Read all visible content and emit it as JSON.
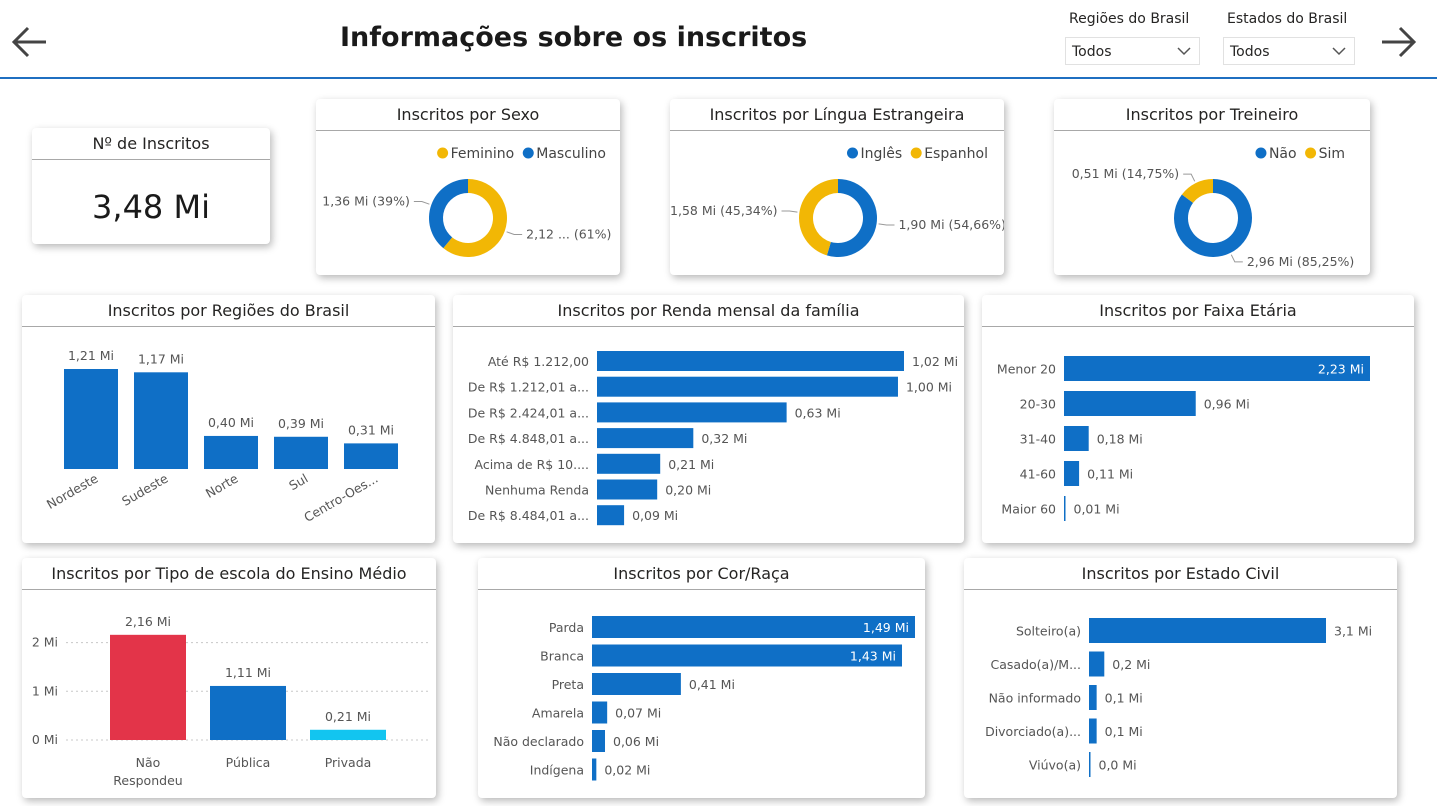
{
  "header": {
    "title": "Informações sobre os inscritos",
    "slicers": [
      {
        "label": "Regiões do Brasil",
        "value": "Todos"
      },
      {
        "label": "Estados do Brasil",
        "value": "Todos"
      }
    ]
  },
  "colors": {
    "blue": "#0f6fc6",
    "yellow": "#f2b705",
    "red": "#e33449",
    "cyan": "#12c5f0",
    "grid": "#c8c8c8"
  },
  "kpi": {
    "title": "Nº de Inscritos",
    "value": "3,48 Mi"
  },
  "chart_data": [
    {
      "id": "sexo",
      "type": "pie",
      "title": "Inscritos por Sexo",
      "legend": [
        "Feminino",
        "Masculino"
      ],
      "values": [
        2.12,
        1.36
      ],
      "colors": [
        "#f2b705",
        "#0f6fc6"
      ],
      "labels": [
        "2,12 ... (61%)",
        "1,36 Mi (39%)"
      ]
    },
    {
      "id": "lingua",
      "type": "pie",
      "title": "Inscritos por Língua Estrangeira",
      "legend": [
        "Inglês",
        "Espanhol"
      ],
      "values": [
        1.9,
        1.58
      ],
      "colors": [
        "#0f6fc6",
        "#f2b705"
      ],
      "labels": [
        "1,90 Mi (54,66%)",
        "1,58 Mi (45,34%)"
      ]
    },
    {
      "id": "treineiro",
      "type": "pie",
      "title": "Inscritos por Treineiro",
      "legend": [
        "Não",
        "Sim"
      ],
      "values": [
        2.96,
        0.51
      ],
      "colors": [
        "#0f6fc6",
        "#f2b705"
      ],
      "labels": [
        "2,96 Mi (85,25%)",
        "0,51 Mi (14,75%)"
      ]
    },
    {
      "id": "regioes",
      "type": "bar",
      "title": "Inscritos por Regiões do Brasil",
      "categories": [
        "Nordeste",
        "Sudeste",
        "Norte",
        "Sul",
        "Centro-Oes..."
      ],
      "values": [
        1.21,
        1.17,
        0.4,
        0.39,
        0.31
      ],
      "labels": [
        "1,21 Mi",
        "1,17 Mi",
        "0,40 Mi",
        "0,39 Mi",
        "0,31 Mi"
      ]
    },
    {
      "id": "renda",
      "type": "bar",
      "title": "Inscritos por Renda mensal da família",
      "categories": [
        "Até R$ 1.212,00",
        "De R$ 1.212,01 a...",
        "De R$ 2.424,01 a...",
        "De R$ 4.848,01 a...",
        "Acima de R$ 10....",
        "Nenhuma Renda",
        "De R$ 8.484,01 a..."
      ],
      "values": [
        1.02,
        1.0,
        0.63,
        0.32,
        0.21,
        0.2,
        0.09
      ],
      "labels": [
        "1,02 Mi",
        "1,00 Mi",
        "0,63 Mi",
        "0,32 Mi",
        "0,21 Mi",
        "0,20 Mi",
        "0,09 Mi"
      ]
    },
    {
      "id": "faixa",
      "type": "bar",
      "title": "Inscritos por Faixa Etária",
      "categories": [
        "Menor 20",
        "20-30",
        "31-40",
        "41-60",
        "Maior 60"
      ],
      "values": [
        2.23,
        0.96,
        0.18,
        0.11,
        0.01
      ],
      "labels": [
        "2,23 Mi",
        "0,96 Mi",
        "0,18 Mi",
        "0,11 Mi",
        "0,01 Mi"
      ]
    },
    {
      "id": "escola",
      "type": "bar",
      "title": "Inscritos por Tipo de escola do Ensino Médio",
      "categories": [
        "Não Respondeu",
        "Pública",
        "Privada"
      ],
      "values": [
        2.16,
        1.11,
        0.21
      ],
      "labels": [
        "2,16 Mi",
        "1,11 Mi",
        "0,21 Mi"
      ],
      "colors": [
        "#e33449",
        "#0f6fc6",
        "#12c5f0"
      ],
      "yticks": [
        "0 Mi",
        "1 Mi",
        "2 Mi"
      ],
      "ylim": [
        0,
        2.3
      ],
      "grid": true
    },
    {
      "id": "cor",
      "type": "bar",
      "title": "Inscritos por Cor/Raça",
      "categories": [
        "Parda",
        "Branca",
        "Preta",
        "Amarela",
        "Não declarado",
        "Indígena"
      ],
      "values": [
        1.49,
        1.43,
        0.41,
        0.07,
        0.06,
        0.02
      ],
      "labels": [
        "1,49 Mi",
        "1,43 Mi",
        "0,41 Mi",
        "0,07 Mi",
        "0,06 Mi",
        "0,02 Mi"
      ]
    },
    {
      "id": "civil",
      "type": "bar",
      "title": "Inscritos por Estado Civil",
      "categories": [
        "Solteiro(a)",
        "Casado(a)/M...",
        "Não informado",
        "Divorciado(a)...",
        "Viúvo(a)"
      ],
      "values": [
        3.1,
        0.2,
        0.1,
        0.1,
        0.0
      ],
      "labels": [
        "3,1 Mi",
        "0,2 Mi",
        "0,1 Mi",
        "0,1 Mi",
        "0,0 Mi"
      ]
    }
  ]
}
